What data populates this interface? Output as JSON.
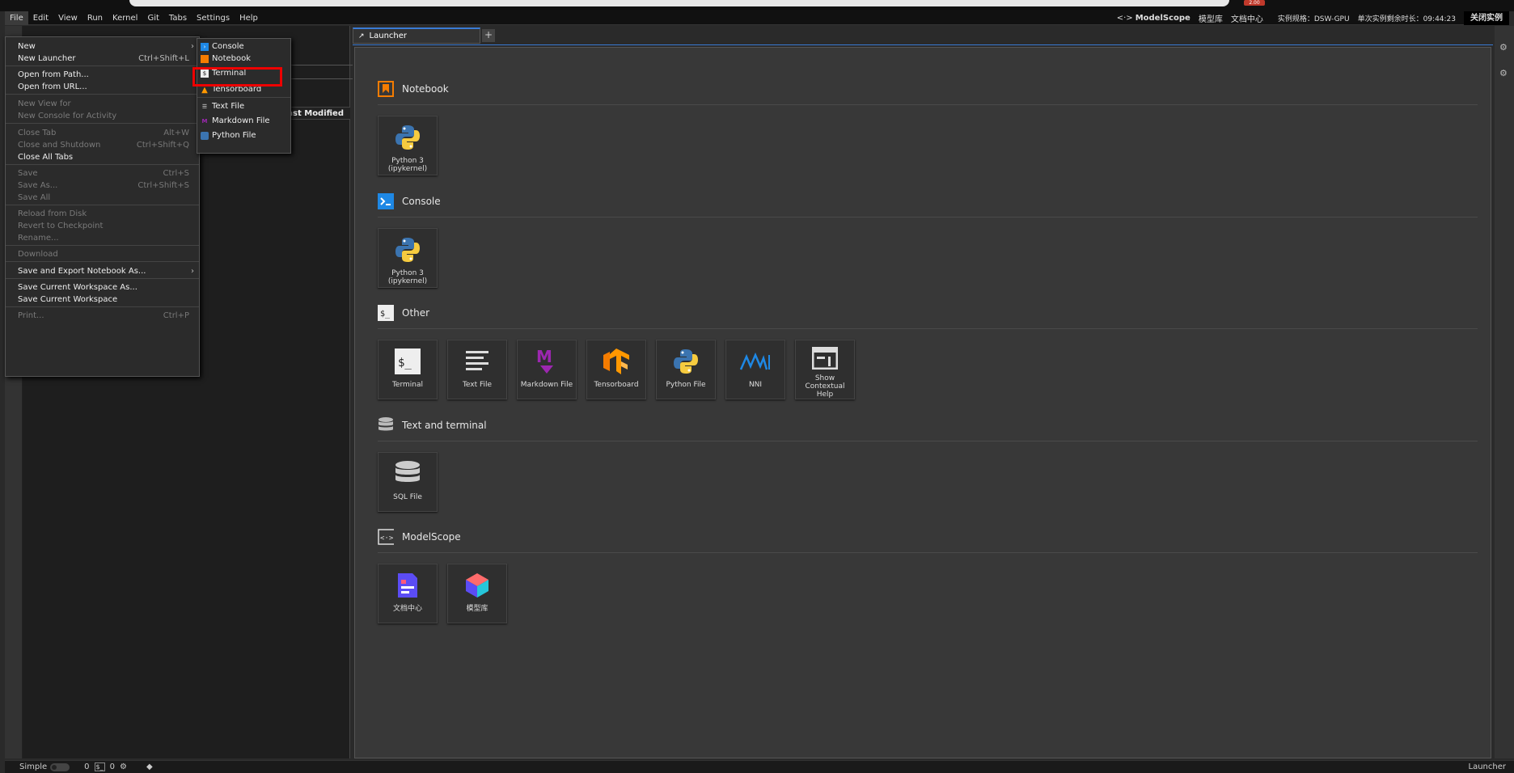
{
  "top": {
    "badge": "2.00"
  },
  "menubar": {
    "items": [
      "File",
      "Edit",
      "View",
      "Run",
      "Kernel",
      "Git",
      "Tabs",
      "Settings",
      "Help"
    ],
    "right": {
      "logo": "ModelScope",
      "link1": "模型库",
      "link2": "文档中心",
      "spec": "实例规格：DSW-GPU",
      "remaining": "单次实例剩余时长：09:44:23",
      "close": "关闭实例"
    }
  },
  "filepanel": {
    "last_modified": "Last Modified"
  },
  "file_menu": {
    "items": [
      {
        "label": "New",
        "shortcut": "",
        "disabled": false,
        "arrow": true
      },
      {
        "label": "New Launcher",
        "shortcut": "Ctrl+Shift+L",
        "disabled": false
      },
      {
        "label": "Open from Path...",
        "shortcut": "",
        "disabled": false
      },
      {
        "label": "Open from URL...",
        "shortcut": "",
        "disabled": false
      },
      {
        "label": "New View for",
        "shortcut": "",
        "disabled": true
      },
      {
        "label": "New Console for Activity",
        "shortcut": "",
        "disabled": true
      },
      {
        "label": "Close Tab",
        "shortcut": "Alt+W",
        "disabled": true
      },
      {
        "label": "Close and Shutdown",
        "shortcut": "Ctrl+Shift+Q",
        "disabled": true
      },
      {
        "label": "Close All Tabs",
        "shortcut": "",
        "disabled": false
      },
      {
        "label": "Save",
        "shortcut": "Ctrl+S",
        "disabled": true
      },
      {
        "label": "Save As...",
        "shortcut": "Ctrl+Shift+S",
        "disabled": true
      },
      {
        "label": "Save All",
        "shortcut": "",
        "disabled": true
      },
      {
        "label": "Reload from Disk",
        "shortcut": "",
        "disabled": true
      },
      {
        "label": "Revert to Checkpoint",
        "shortcut": "",
        "disabled": true
      },
      {
        "label": "Rename...",
        "shortcut": "",
        "disabled": true
      },
      {
        "label": "Download",
        "shortcut": "",
        "disabled": true
      },
      {
        "label": "Save and Export Notebook As...",
        "shortcut": "",
        "disabled": false,
        "arrow": true
      },
      {
        "label": "Save Current Workspace As...",
        "shortcut": "",
        "disabled": false
      },
      {
        "label": "Save Current Workspace",
        "shortcut": "",
        "disabled": false
      },
      {
        "label": "Print...",
        "shortcut": "Ctrl+P",
        "disabled": true
      }
    ]
  },
  "new_submenu": {
    "items": [
      "Console",
      "Notebook",
      "Terminal",
      "Tensorboard",
      "Text File",
      "Markdown File",
      "Python File"
    ]
  },
  "tabs": {
    "launcher": "Launcher",
    "add": "+"
  },
  "launcher": {
    "sections": [
      {
        "title": "Notebook",
        "cards": [
          "Python 3 (ipykernel)"
        ]
      },
      {
        "title": "Console",
        "cards": [
          "Python 3 (ipykernel)"
        ]
      },
      {
        "title": "Other",
        "cards": [
          "Terminal",
          "Text File",
          "Markdown File",
          "Tensorboard",
          "Python File",
          "NNI",
          "Show Contextual Help"
        ]
      },
      {
        "title": "Text and terminal",
        "cards": [
          "SQL File"
        ]
      },
      {
        "title": "ModelScope",
        "cards": [
          "文档中心",
          "模型库"
        ]
      }
    ]
  },
  "statusbar": {
    "mode": "Simple",
    "count1": "0",
    "count2": "0",
    "right": "Launcher"
  },
  "colors": {
    "accent": "#3a7bd5",
    "highlight": "#e00000",
    "notebook_orange": "#f57c00"
  }
}
